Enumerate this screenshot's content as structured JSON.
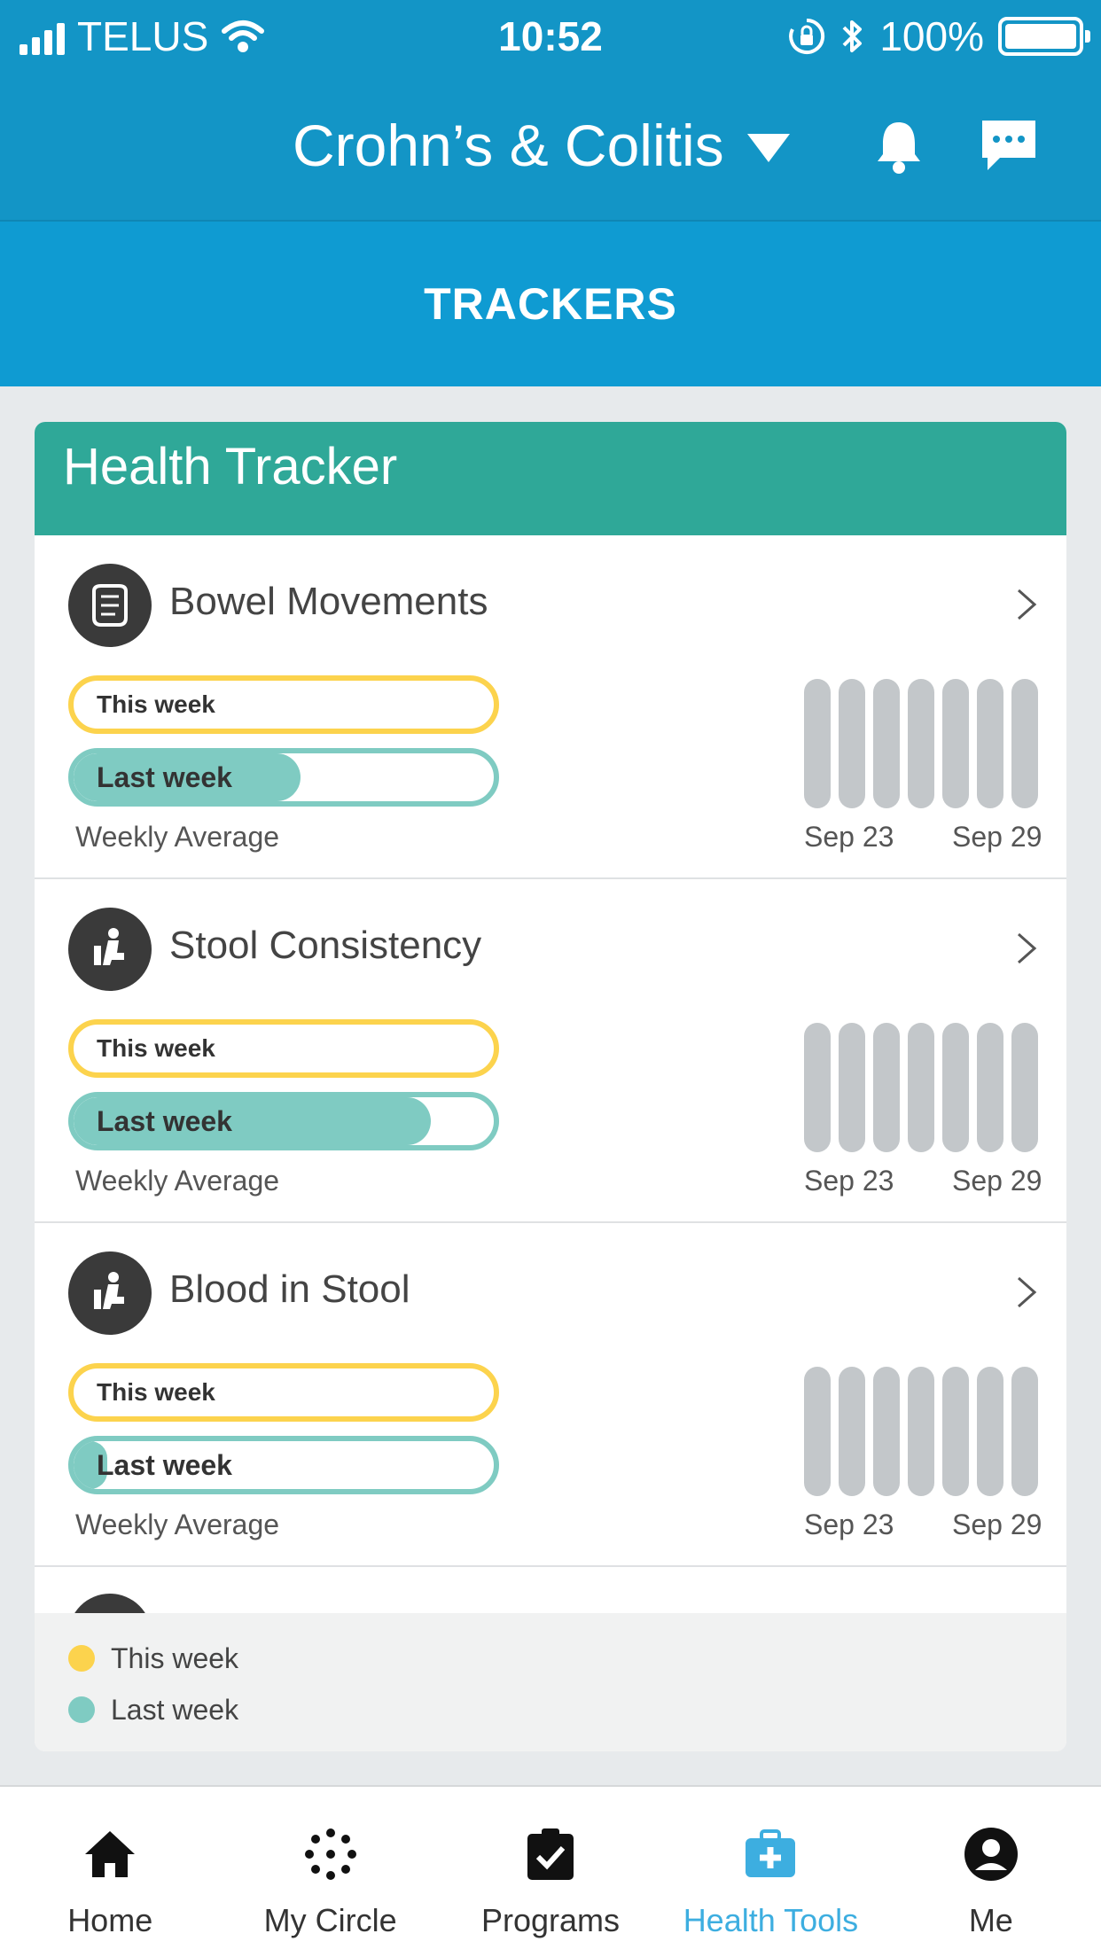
{
  "status_bar": {
    "carrier": "TELUS",
    "time": "10:52",
    "battery": "100%"
  },
  "header": {
    "title": "Crohn’s & Colitis"
  },
  "subheader": {
    "title": "TRACKERS"
  },
  "card": {
    "title": "Health Tracker",
    "trackers": [
      {
        "name": "Bowel Movements",
        "this_label": "This week",
        "last_label": "Last week",
        "last_week_fill": 0.54,
        "weekly_avg": "Weekly Average",
        "date_start": "Sep 23",
        "date_end": "Sep 29"
      },
      {
        "name": "Stool Consistency",
        "this_label": "This week",
        "last_label": "Last week",
        "last_week_fill": 0.85,
        "weekly_avg": "Weekly Average",
        "date_start": "Sep 23",
        "date_end": "Sep 29"
      },
      {
        "name": "Blood in Stool",
        "this_label": "This week",
        "last_label": "Last week",
        "last_week_fill": 0.08,
        "weekly_avg": "Weekly Average",
        "date_start": "Sep 23",
        "date_end": "Sep 29"
      }
    ],
    "legend": {
      "this_week": "This week",
      "last_week": "Last week"
    }
  },
  "colors": {
    "header": "#1395c6",
    "subheader": "#0f9bd2",
    "card_header": "#2fa898",
    "this_week": "#fcd34d",
    "last_week": "#7fcbc2",
    "active_tab": "#3daee0"
  },
  "tabs": [
    {
      "label": "Home",
      "icon": "home-icon"
    },
    {
      "label": "My Circle",
      "icon": "circle-dots-icon"
    },
    {
      "label": "Programs",
      "icon": "clipboard-check-icon"
    },
    {
      "label": "Health Tools",
      "icon": "medkit-icon",
      "active": true
    },
    {
      "label": "Me",
      "icon": "user-icon"
    }
  ]
}
